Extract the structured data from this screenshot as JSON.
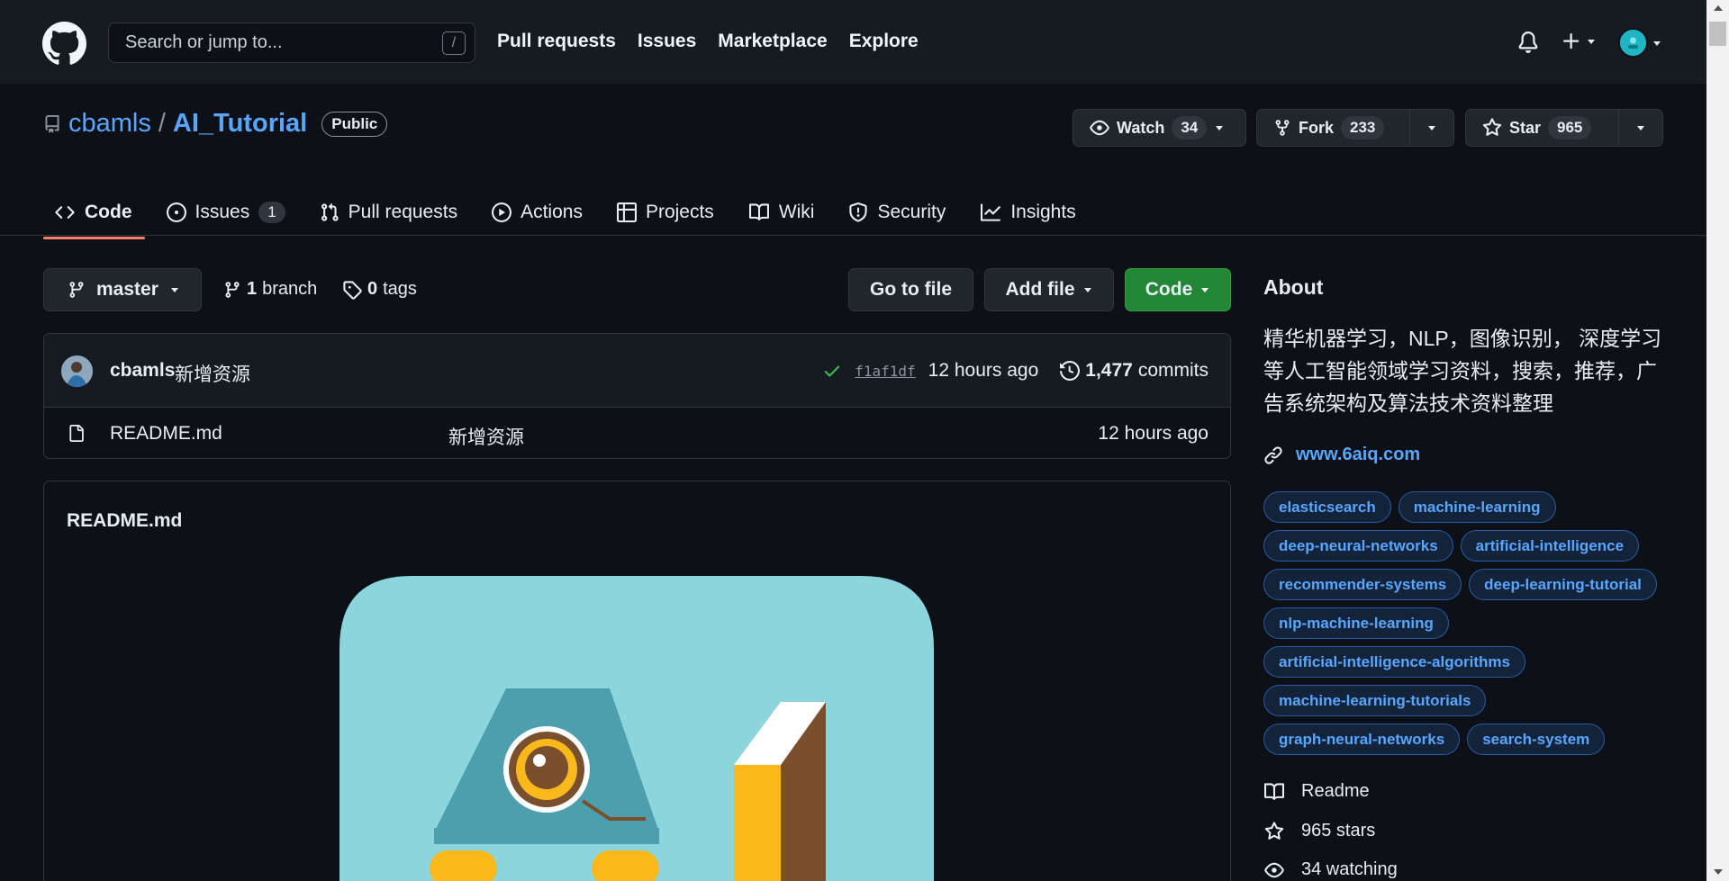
{
  "header": {
    "search_placeholder": "Search or jump to...",
    "search_shortcut": "/",
    "nav": [
      "Pull requests",
      "Issues",
      "Marketplace",
      "Explore"
    ]
  },
  "repo": {
    "owner": "cbamls",
    "separator": "/",
    "name": "AI_Tutorial",
    "visibility": "Public",
    "watch_label": "Watch",
    "watch_count": "34",
    "fork_label": "Fork",
    "fork_count": "233",
    "star_label": "Star",
    "star_count": "965"
  },
  "tabs": [
    {
      "label": "Code",
      "icon": "code-icon"
    },
    {
      "label": "Issues",
      "icon": "issue-icon",
      "count": "1"
    },
    {
      "label": "Pull requests",
      "icon": "pull-request-icon"
    },
    {
      "label": "Actions",
      "icon": "play-icon"
    },
    {
      "label": "Projects",
      "icon": "table-icon"
    },
    {
      "label": "Wiki",
      "icon": "book-icon"
    },
    {
      "label": "Security",
      "icon": "shield-icon"
    },
    {
      "label": "Insights",
      "icon": "graph-icon"
    }
  ],
  "toolbar": {
    "branch": "master",
    "branches_count": "1",
    "branches_label": "branch",
    "tags_count": "0",
    "tags_label": "tags",
    "go_to_file": "Go to file",
    "add_file": "Add file",
    "code": "Code"
  },
  "commit": {
    "author": "cbamls",
    "message": "新增资源",
    "sha": "f1af1df",
    "time": "12 hours ago",
    "commits_count": "1,477",
    "commits_label": "commits"
  },
  "files": [
    {
      "name": "README.md",
      "message": "新增资源",
      "time": "12 hours ago"
    }
  ],
  "readme": {
    "title": "README.md"
  },
  "about": {
    "heading": "About",
    "description": "精华机器学习，NLP，图像识别， 深度学习等人工智能领域学习资料，搜索，推荐，广告系统架构及算法技术资料整理",
    "website": "www.6aiq.com",
    "topics": [
      "elasticsearch",
      "machine-learning",
      "deep-neural-networks",
      "artificial-intelligence",
      "recommender-systems",
      "deep-learning-tutorial",
      "nlp-machine-learning",
      "artificial-intelligence-algorithms",
      "machine-learning-tutorials",
      "graph-neural-networks",
      "search-system"
    ],
    "readme_label": "Readme",
    "stars": "965 stars",
    "watching": "34 watching"
  },
  "colors": {
    "accent_blue": "#58a6ff",
    "green_button": "#238636",
    "tab_underline": "#f78166",
    "background": "#0d1117"
  }
}
